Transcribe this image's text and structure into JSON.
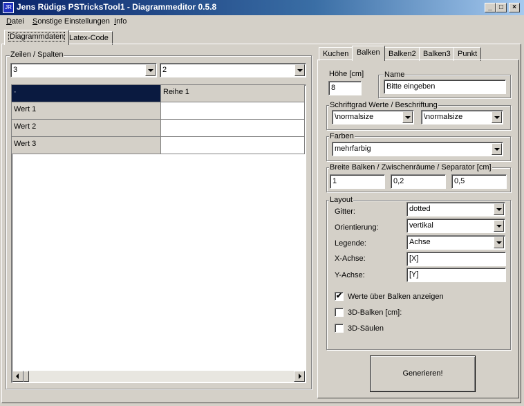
{
  "window": {
    "title": "Jens Rüdigs PSTricksTool1 - Diagrammeditor 0.5.8",
    "icon_text": "JR",
    "minimize": "_",
    "maximize": "□",
    "close": "×"
  },
  "menu": [
    "Datei",
    "Sonstige Einstellungen",
    "Info"
  ],
  "main_tabs": [
    "Diagrammdaten",
    "Latex-Code"
  ],
  "left": {
    "group_label": "Zeilen / Spalten",
    "rows_value": "3",
    "cols_value": "2",
    "grid": {
      "corner": "·",
      "column_headers": [
        "Reihe 1"
      ],
      "row_headers": [
        "Wert 1",
        "Wert 2",
        "Wert 3"
      ]
    }
  },
  "right_tabs": [
    "Kuchen",
    "Balken",
    "Balken2",
    "Balken3",
    "Punkt"
  ],
  "balken": {
    "hoehe_label": "Höhe [cm]",
    "hoehe_value": "8",
    "name_label": "Name",
    "name_value": "Bitte eingeben",
    "schrift_label": "Schriftgrad Werte / Beschriftung",
    "schrift_werte": "\\normalsize",
    "schrift_beschriftung": "\\normalsize",
    "farben_label": "Farben",
    "farben_value": "mehrfarbig",
    "breite_label": "Breite Balken / Zwischenräume / Separator [cm]",
    "breite_balken": "1",
    "zwischenraeume": "0,2",
    "separator": "0,5",
    "layout_label": "Layout",
    "gitter_label": "Gitter:",
    "gitter_value": "dotted",
    "orientierung_label": "Orientierung:",
    "orientierung_value": "vertikal",
    "legende_label": "Legende:",
    "legende_value": "Achse",
    "xachse_label": "X-Achse:",
    "xachse_value": "[X]",
    "yachse_label": "Y-Achse:",
    "yachse_value": "[Y]",
    "checkboxes": [
      {
        "label": "Werte über Balken anzeigen",
        "checked": true,
        "mark": "✔"
      },
      {
        "label": "3D-Balken [cm]:",
        "checked": false,
        "mark": ""
      },
      {
        "label": "3D-Säulen",
        "checked": false,
        "mark": ""
      }
    ]
  },
  "generate_label": "Generieren!"
}
